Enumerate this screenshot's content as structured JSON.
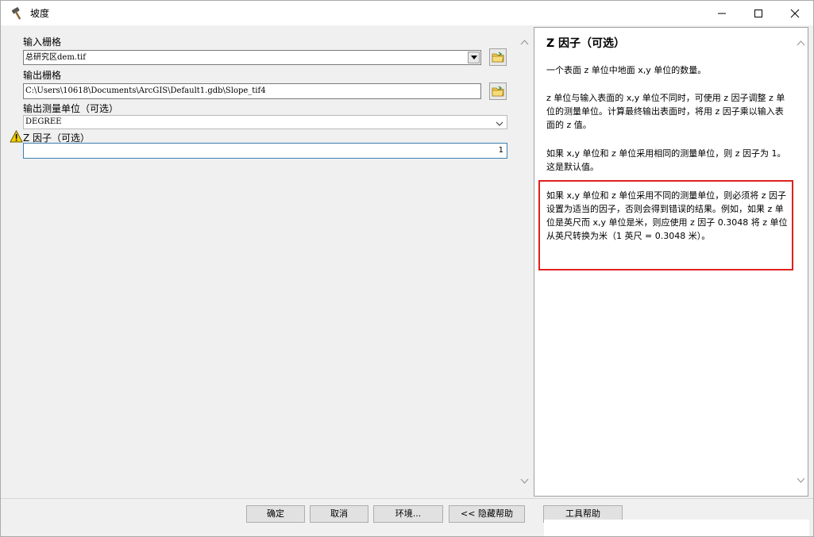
{
  "window": {
    "title": "坡度"
  },
  "form": {
    "input_raster": {
      "label": "输入栅格",
      "value": "总研究区dem.tif"
    },
    "output_raster": {
      "label": "输出栅格",
      "value": "C:\\Users\\10618\\Documents\\ArcGIS\\Default1.gdb\\Slope_tif4"
    },
    "measurement": {
      "label": "输出测量单位（可选）",
      "value": "DEGREE"
    },
    "z_factor": {
      "label": "Z 因子（可选）",
      "value": "1"
    }
  },
  "help": {
    "title": "Z 因子（可选）",
    "paragraphs": [
      "一个表面 z 单位中地面 x,y 单位的数量。",
      "z 单位与输入表面的 x,y 单位不同时，可使用 z 因子调整 z 单位的测量单位。计算最终输出表面时，将用 z 因子乘以输入表面的 z 值。",
      "如果 x,y 单位和 z 单位采用相同的测量单位，则 z 因子为 1。这是默认值。",
      "如果 x,y 单位和 z 单位采用不同的测量单位，则必须将 z 因子设置为适当的因子，否则会得到错误的结果。例如，如果 z 单位是英尺而 x,y 单位是米，则应使用 z 因子 0.3048 将 z 单位从英尺转换为米（1 英尺 = 0.3048 米）。"
    ]
  },
  "buttons": {
    "ok": "确定",
    "cancel": "取消",
    "environments": "环境...",
    "hide_help": "<< 隐藏帮助",
    "tool_help": "工具帮助"
  },
  "colors": {
    "highlight": "#e02020",
    "warning": "#f5d000"
  }
}
